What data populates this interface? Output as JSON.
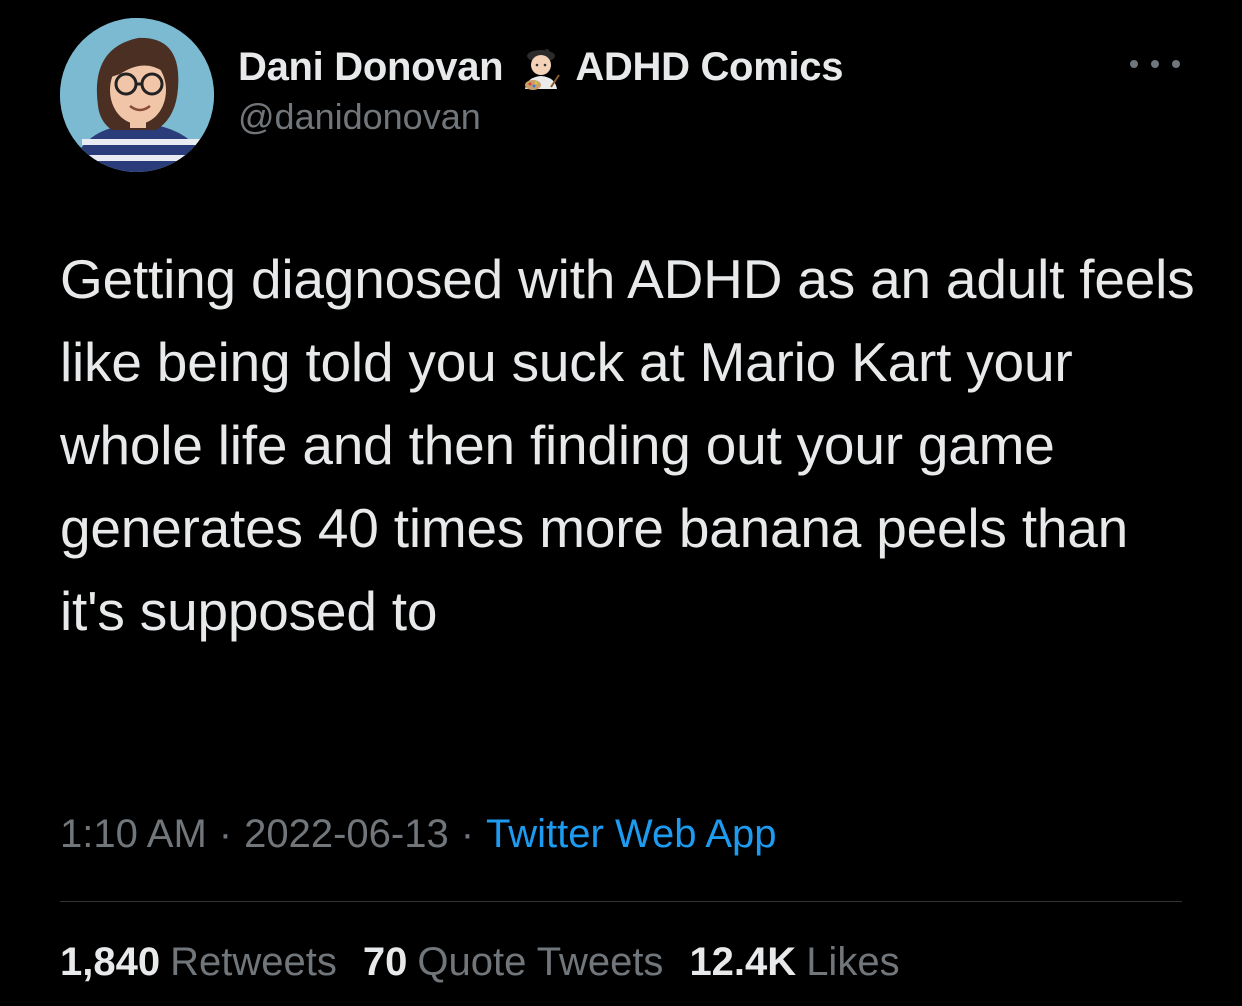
{
  "author": {
    "display_name": "Dani Donovan",
    "badge_icon": "artist-emoji",
    "badge_text": "ADHD Comics",
    "handle": "@danidonovan"
  },
  "tweet": {
    "text": "Getting diagnosed with ADHD as an adult feels like being told you suck at Mario Kart your whole life and then finding out your game generates 40 times more banana peels than it's supposed to",
    "time": "1:10 AM",
    "separator": "·",
    "date": "2022-06-13",
    "source": "Twitter Web App"
  },
  "stats": {
    "retweets_count": "1,840",
    "retweets_label": "Retweets",
    "quotes_count": "70",
    "quotes_label": "Quote Tweets",
    "likes_count": "12.4K",
    "likes_label": "Likes"
  },
  "colors": {
    "background": "#000000",
    "text_primary": "#e7e9ea",
    "text_secondary": "#71767b",
    "link": "#1d9bf0",
    "divider": "#2f3336"
  }
}
